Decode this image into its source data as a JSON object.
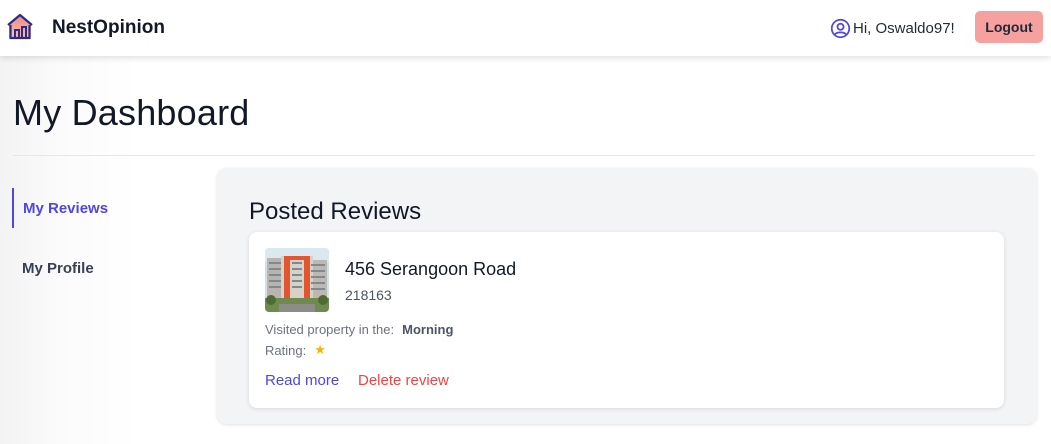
{
  "header": {
    "brand": "NestOpinion",
    "greeting": "Hi, Oswaldo97!",
    "logout_label": "Logout"
  },
  "page": {
    "title": "My Dashboard"
  },
  "sidebar": {
    "items": [
      {
        "label": "My Reviews",
        "active": true
      },
      {
        "label": "My Profile",
        "active": false
      }
    ]
  },
  "main": {
    "section_title": "Posted Reviews",
    "reviews": [
      {
        "address": "456 Serangoon Road",
        "postal_code": "218163",
        "visited_label": "Visited property in the:",
        "visited_value": "Morning",
        "rating_label": "Rating:",
        "rating_stars": 1,
        "rating_glyph": "★",
        "read_more_label": "Read more",
        "delete_label": "Delete review"
      }
    ]
  },
  "colors": {
    "accent": "#4f46e5",
    "logout_bg": "#f6a0a0",
    "danger": "#ef4444",
    "star": "#f5b400"
  },
  "icons": {
    "logo": "house-logo-icon",
    "user": "user-circle-icon",
    "star": "star-icon"
  }
}
